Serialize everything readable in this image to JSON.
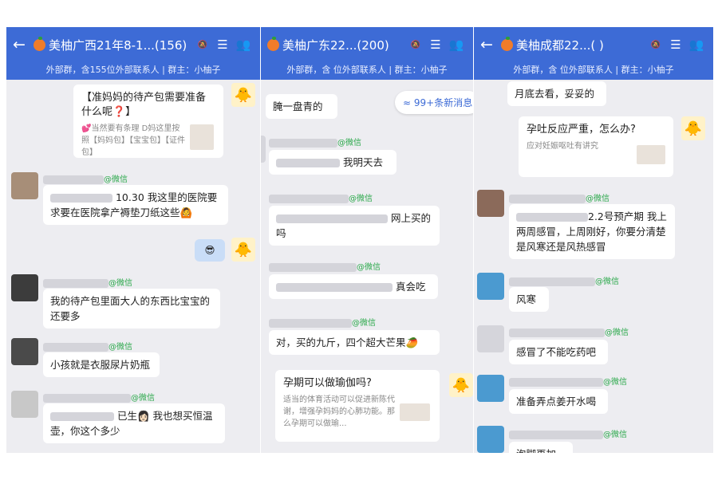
{
  "p1": {
    "title": "美柚广西21年8-1...(156)",
    "subtitle": "外部群，含155位外部联系人 | 群主：小柚子",
    "card_title": "【准妈妈的待产包需要准备什么呢❓】",
    "card_desc": "💕当然要有条理 D妈这里按照【妈妈包】【宝宝包】【证件包】",
    "wechat": "@微信",
    "m1_text": "10.30 我这里的医院要求要在医院拿产褥垫刀纸这些🙆",
    "m2_text": "我的待产包里面大人的东西比宝宝的还要多",
    "m3_text": "小孩就是衣服尿片奶瓶",
    "m4_text": "已生👩🏻 我也想买恒温壶，你这个多少",
    "emoji": "😎"
  },
  "p2": {
    "title": "美柚广东22...(200)",
    "subtitle": "外部群，含   位外部联系人 | 群主：小柚子",
    "wechat": "@微信",
    "new_msgs": "≈ 99+条新消息",
    "m0_text": "腌一盘青的",
    "m1_text": "我明天去",
    "m2_text": "网上买的吗",
    "m3_text": "真会吃",
    "m4_text": "对，买的九斤，四个超大芒果🥭",
    "card_title": "孕期可以做瑜伽吗?",
    "card_desc": "适当的体育活动可以促进新陈代谢，增强孕妈妈的心肺功能。那么孕期可以做瑜..."
  },
  "p3": {
    "title": "美柚成都22...(   )",
    "subtitle": "外部群，含   位外部联系人 | 群主：小柚子",
    "wechat": "@微信",
    "m0_text": "月底去看，妥妥的",
    "card_title": "孕吐反应严重，怎么办?",
    "card_desc": "应对妊娠呕吐有讲究",
    "m1_text": "2.2号预产期 我上两周感冒，上周刚好，你要分清楚是风寒还是风热感冒",
    "m2_text": "风寒",
    "m3_text": "感冒了不能吃药吧",
    "m4_text": "准备弄点姜开水喝",
    "m5_text": "泡脚再加"
  },
  "colors": {
    "header": "#3d6bd6",
    "chat_bg": "#ededf1",
    "sender_name": "#2aa84a"
  }
}
